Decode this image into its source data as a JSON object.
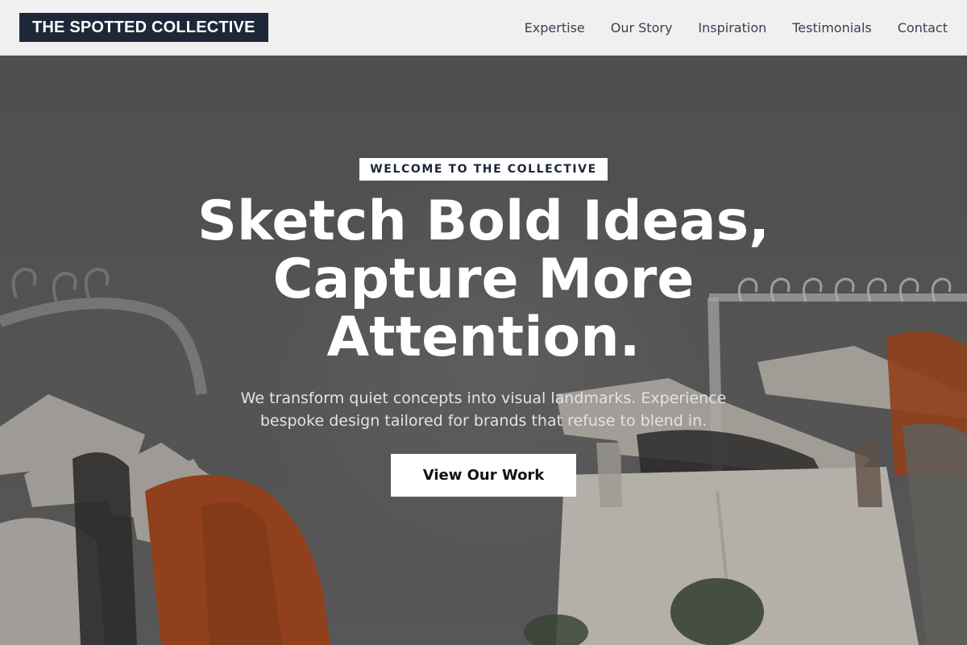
{
  "brand": {
    "logo_text": "THE SPOTTED COLLECTIVE"
  },
  "nav": {
    "items": [
      {
        "label": "Expertise"
      },
      {
        "label": "Our Story"
      },
      {
        "label": "Inspiration"
      },
      {
        "label": "Testimonials"
      },
      {
        "label": "Contact"
      }
    ]
  },
  "hero": {
    "eyebrow": "WELCOME TO THE COLLECTIVE",
    "headline_lines": [
      "Sketch Bold Ideas,",
      "Capture More",
      "Attention."
    ],
    "subtext": "We transform quiet concepts into visual landmarks. Experience bespoke design tailored for brands that refuse to blend in.",
    "cta_label": "View Our Work",
    "background_description_icon": "clothing-rack-photo"
  },
  "colors": {
    "navbar_bg": "#f0f0f0",
    "logo_bg": "#1e2738",
    "nav_text": "#3a4050",
    "hero_overlay": "#5a5a5a",
    "accent_rust": "#a8461a",
    "white": "#ffffff"
  }
}
